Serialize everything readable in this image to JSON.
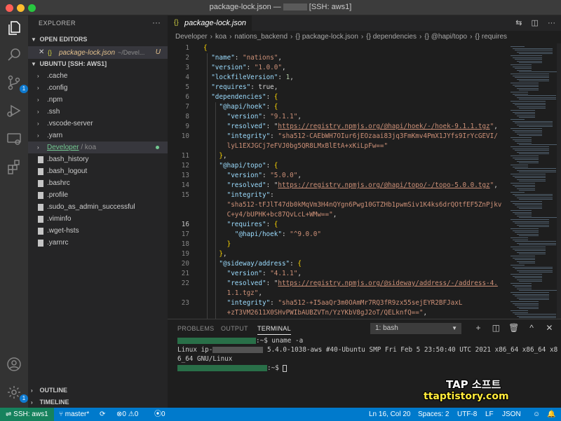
{
  "window": {
    "title_prefix": "package-lock.json —",
    "title_suffix": "[SSH: aws1]"
  },
  "activity_bar": {
    "items": [
      {
        "name": "explorer-icon",
        "active": true
      },
      {
        "name": "search-icon"
      },
      {
        "name": "source-control-icon",
        "badge": "1"
      },
      {
        "name": "run-debug-icon"
      },
      {
        "name": "remote-explorer-icon"
      },
      {
        "name": "extensions-icon"
      }
    ],
    "bottom": [
      {
        "name": "account-icon"
      },
      {
        "name": "settings-gear-icon",
        "badge": "1"
      }
    ]
  },
  "sidebar": {
    "title": "EXPLORER",
    "more": "···",
    "open_editors_label": "OPEN EDITORS",
    "open_editor": {
      "close": "✕",
      "icon": "{}",
      "name": "package-lock.json",
      "path": "~/Devel...",
      "status": "U"
    },
    "workspace_label": "UBUNTU [SSH: AWS1]",
    "items": [
      {
        "label": ".cache",
        "kind": "folder"
      },
      {
        "label": ".config",
        "kind": "folder"
      },
      {
        "label": ".npm",
        "kind": "folder"
      },
      {
        "label": ".ssh",
        "kind": "folder"
      },
      {
        "label": ".vscode-server",
        "kind": "folder"
      },
      {
        "label": ".yarn",
        "kind": "folder"
      },
      {
        "label": "Developer",
        "suffix": "/ koa",
        "kind": "folder",
        "selected": true
      },
      {
        "label": ".bash_history",
        "kind": "file"
      },
      {
        "label": ".bash_logout",
        "kind": "file"
      },
      {
        "label": ".bashrc",
        "kind": "file"
      },
      {
        "label": ".profile",
        "kind": "file"
      },
      {
        "label": ".sudo_as_admin_successful",
        "kind": "file"
      },
      {
        "label": ".viminfo",
        "kind": "file"
      },
      {
        "label": ".wget-hsts",
        "kind": "file"
      },
      {
        "label": ".yarnrc",
        "kind": "file"
      }
    ],
    "outline_label": "OUTLINE",
    "timeline_label": "TIMELINE"
  },
  "tab": {
    "icon": "{}",
    "name": "package-lock.json"
  },
  "breadcrumb": [
    "Developer",
    "koa",
    "nations_backend",
    "{} package-lock.json",
    "{} dependencies",
    "{} @hapi/topo",
    "{} requires"
  ],
  "code_lines": [
    {
      "n": "1",
      "text": "{"
    },
    {
      "n": "2",
      "text": "  \"name\": \"nations\","
    },
    {
      "n": "3",
      "text": "  \"version\": \"1.0.0\","
    },
    {
      "n": "4",
      "text": "  \"lockfileVersion\": 1,"
    },
    {
      "n": "5",
      "text": "  \"requires\": true,"
    },
    {
      "n": "6",
      "text": "  \"dependencies\": {"
    },
    {
      "n": "7",
      "text": "    \"@hapi/hoek\": {"
    },
    {
      "n": "8",
      "text": "      \"version\": \"9.1.1\","
    },
    {
      "n": "9",
      "text": "      \"resolved\": \"https://registry.npmjs.org/@hapi/hoek/-/hoek-9.1.1.tgz\","
    },
    {
      "n": "10",
      "text": "      \"integrity\": \"sha512-CAEbWH7OIur6jEOzaai83jq3FmKmv4PmX1JYfs9IrYcGEVI/"
    },
    {
      "n": "",
      "text": "      lyL1EXJGCj7eFVJ0bg5QR8LMxBlEtA+xKiLpFw==\""
    },
    {
      "n": "11",
      "text": "    },"
    },
    {
      "n": "12",
      "text": "    \"@hapi/topo\": {"
    },
    {
      "n": "13",
      "text": "      \"version\": \"5.0.0\","
    },
    {
      "n": "14",
      "text": "      \"resolved\": \"https://registry.npmjs.org/@hapi/topo/-/topo-5.0.0.tgz\","
    },
    {
      "n": "15",
      "text": "      \"integrity\":"
    },
    {
      "n": "",
      "text": "      \"sha512-tFJlT47db0kMqVm3H4nQYgn6Pwg10GTZHb1pwmSiv1K4ks6drQOtfEF5ZnPjkv"
    },
    {
      "n": "",
      "text": "      C+y4/bUPHK+bc87QvLcL+WMw==\","
    },
    {
      "n": "16",
      "text": "      \"requires\": {"
    },
    {
      "n": "17",
      "text": "        \"@hapi/hoek\": \"^9.0.0\""
    },
    {
      "n": "18",
      "text": "      }"
    },
    {
      "n": "19",
      "text": "    },"
    },
    {
      "n": "20",
      "text": "    \"@sideway/address\": {"
    },
    {
      "n": "21",
      "text": "      \"version\": \"4.1.1\","
    },
    {
      "n": "22",
      "text": "      \"resolved\": \"https://registry.npmjs.org/@sideway/address/-/address-4."
    },
    {
      "n": "",
      "text": "      1.1.tgz\","
    },
    {
      "n": "23",
      "text": "      \"integrity\": \"sha512-+I5aaQr3m0OAmMr7RQ3fR9zx55sejEYR2BFJaxL"
    },
    {
      "n": "",
      "text": "      +zT3VM2611X0SHvPWIbAUBZVTn/YzYKbV8gJ2oT/QELknfQ==\","
    }
  ],
  "panel": {
    "tabs": [
      "PROBLEMS",
      "OUTPUT",
      "TERMINAL"
    ],
    "active_tab": "TERMINAL",
    "terminal_select": "1: bash",
    "actions": [
      "+",
      "◫",
      "🗑",
      "^",
      "✕"
    ],
    "lines": [
      {
        "prompt": ":~$ ",
        "cmd": "uname -a"
      },
      {
        "out_prefix": "Linux ip-",
        "out": " 5.4.0-1038-aws #40-Ubuntu SMP Fri Feb 5 23:50:40 UTC 2021 x86_64 x86_64 x8"
      },
      {
        "out": "6_64 GNU/Linux"
      },
      {
        "prompt": ":~$ "
      }
    ]
  },
  "watermark": {
    "title": "TAP 소프트",
    "url": "ttaptistory.com"
  },
  "statusbar": {
    "remote": "SSH: aws1",
    "branch": "master*",
    "sync": "⟳",
    "errors": "0",
    "warnings": "0",
    "ports": "0",
    "position": "Ln 16, Col 20",
    "spaces": "Spaces: 2",
    "encoding": "UTF-8",
    "eol": "LF",
    "language": "JSON"
  },
  "colors": {
    "accent": "#007acc",
    "remote": "#16825d",
    "badge": "#0e7ad0"
  }
}
